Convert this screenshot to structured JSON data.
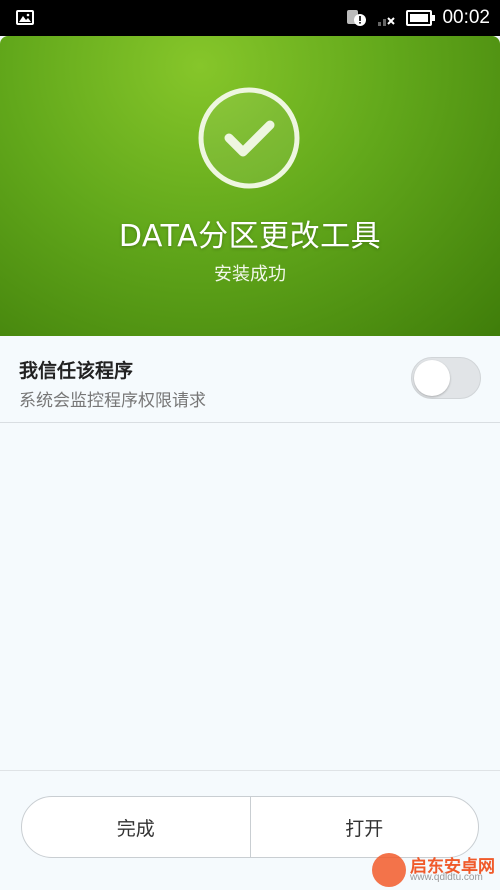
{
  "status_bar": {
    "time": "00:02",
    "icons": [
      "image-icon",
      "sim-warning-icon",
      "no-signal-icon",
      "battery-icon"
    ]
  },
  "hero": {
    "icon": "check-circle-icon",
    "app_name": "DATA分区更改工具",
    "status": "安装成功",
    "colors": {
      "gradient_light": "#86c62a",
      "gradient_dark": "#3f7d0a"
    }
  },
  "trust": {
    "title": "我信任该程序",
    "subtitle": "系统会监控程序权限请求",
    "toggle_on": false
  },
  "actions": {
    "done_label": "完成",
    "open_label": "打开"
  },
  "watermark": {
    "brand": "启东安卓网",
    "url": "www.qdldtu.com"
  }
}
